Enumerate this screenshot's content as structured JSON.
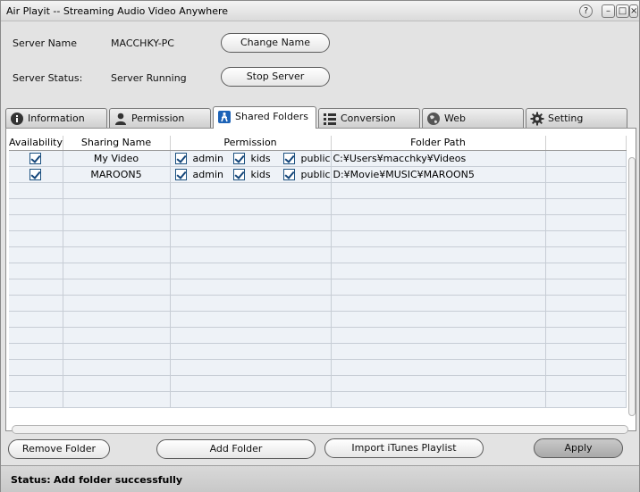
{
  "window": {
    "title": "Air Playit -- Streaming Audio Video Anywhere",
    "help": "?",
    "minimize": "–",
    "maximize": "□",
    "close": "×"
  },
  "server": {
    "name_label": "Server Name",
    "name_value": "MACCHKY-PC",
    "change_name_button": "Change Name",
    "status_label": "Server Status:",
    "status_value": "Server Running",
    "stop_button": "Stop Server"
  },
  "tabs": [
    {
      "label": "Information",
      "icon": "info-icon"
    },
    {
      "label": "Permission",
      "icon": "user-icon"
    },
    {
      "label": "Shared Folders",
      "icon": "shared-folder-icon",
      "active": true
    },
    {
      "label": "Conversion",
      "icon": "conversion-icon"
    },
    {
      "label": "Web",
      "icon": "web-icon"
    },
    {
      "label": "Setting",
      "icon": "gear-icon"
    }
  ],
  "table": {
    "columns": [
      "Availability",
      "Sharing Name",
      "Permission",
      "Folder Path",
      ""
    ],
    "permission_labels": [
      "admin",
      "kids",
      "public"
    ],
    "rows": [
      {
        "available": true,
        "name": "My Video",
        "perms": [
          true,
          true,
          true
        ],
        "path": "C:¥Users¥macchky¥Videos"
      },
      {
        "available": true,
        "name": "MAROON5",
        "perms": [
          true,
          true,
          true
        ],
        "path": "D:¥Movie¥MUSIC¥MAROON5"
      }
    ],
    "empty_rows": 14
  },
  "buttons": {
    "remove_folder": "Remove Folder",
    "add_folder": "Add Folder",
    "import_itunes": "Import iTunes Playlist",
    "apply": "Apply"
  },
  "status": {
    "label": "Status:",
    "text": "Add folder successfully"
  },
  "colors": {
    "window_bg": "#e3e3e3",
    "row_bg": "#eef2f7",
    "checkbox_mark": "#14467a"
  }
}
